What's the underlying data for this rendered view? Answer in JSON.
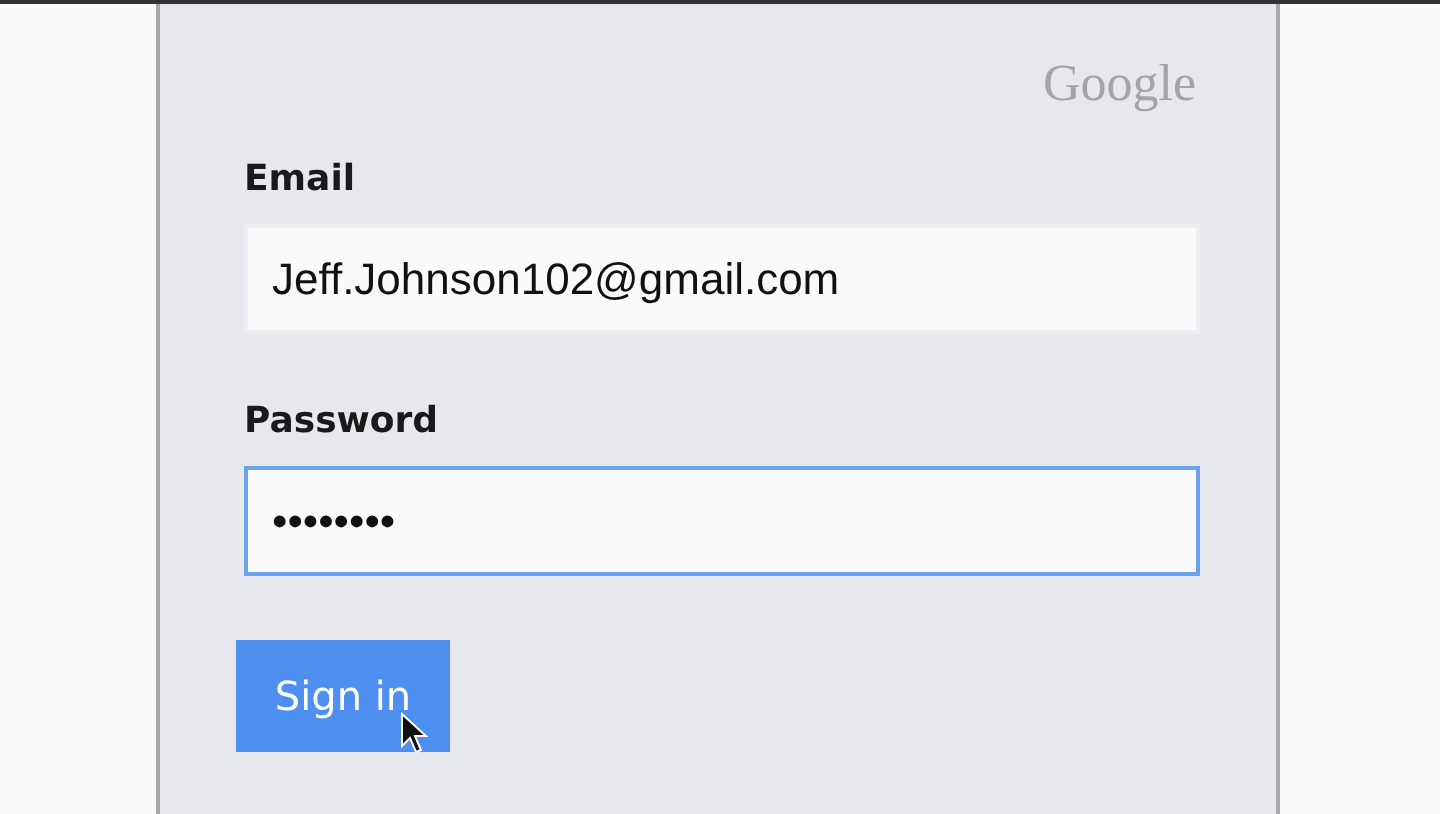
{
  "logo": "Google",
  "fields": [
    {
      "label": "Email",
      "value": "Jeff.Johnson102@gmail.com",
      "focused": false
    },
    {
      "label": "Password",
      "value": "••••••••",
      "focused": true
    }
  ],
  "button": {
    "label": "Sign in"
  }
}
